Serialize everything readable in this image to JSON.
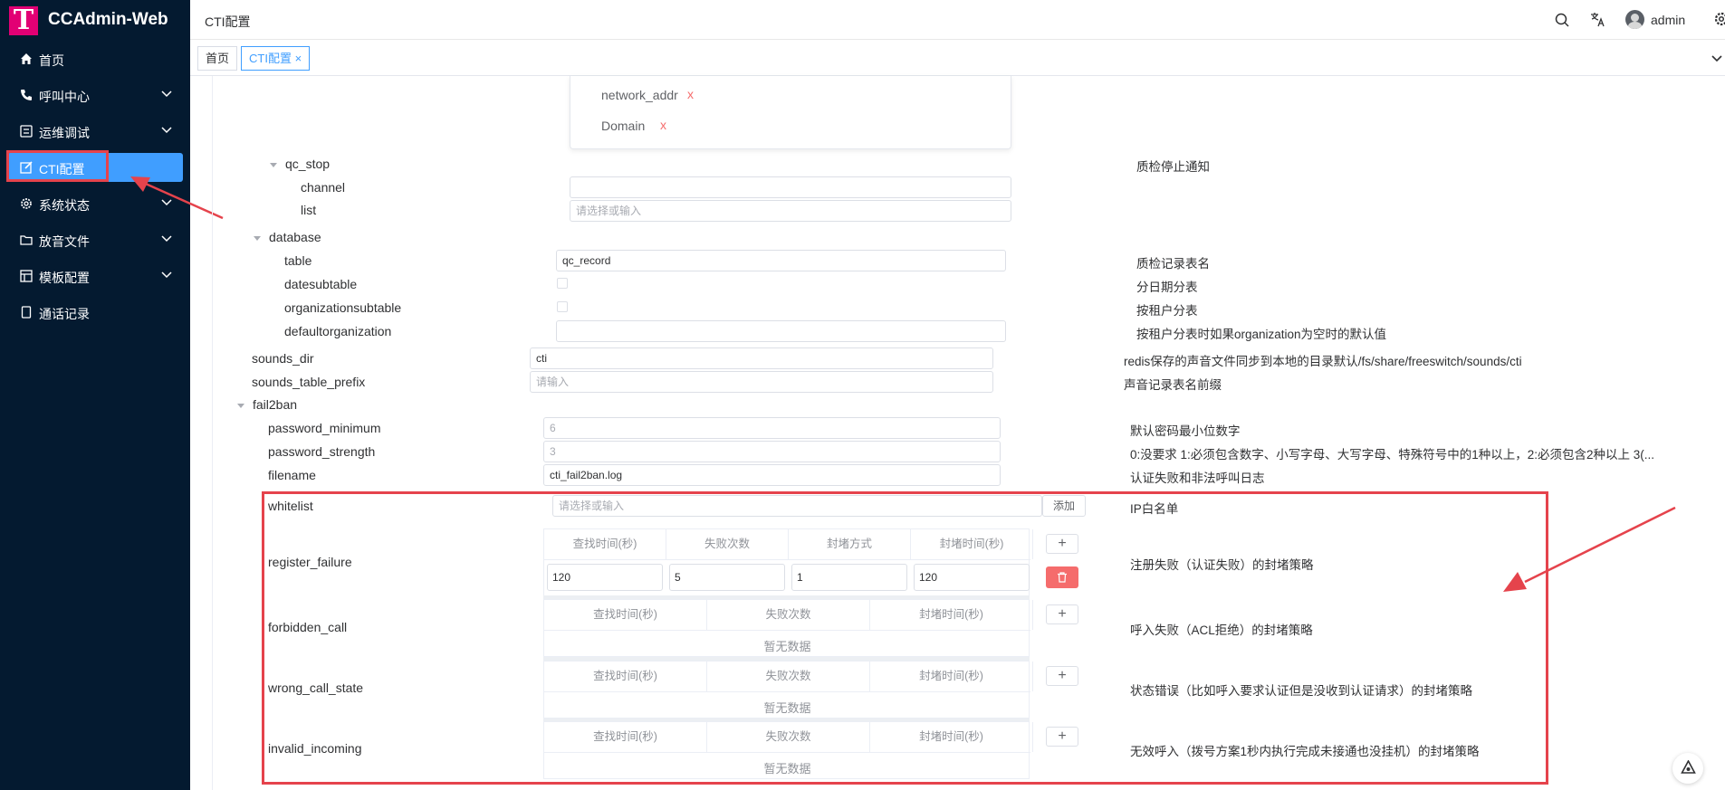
{
  "app": {
    "brand": "CCAdmin-Web",
    "logo_letter": "T"
  },
  "sidebar": {
    "items": [
      {
        "label": "首页",
        "icon": "home-icon"
      },
      {
        "label": "呼叫中心",
        "icon": "phone-icon"
      },
      {
        "label": "运维调试",
        "icon": "debug-icon"
      },
      {
        "label": "CTI配置",
        "icon": "edit-icon",
        "active": true
      },
      {
        "label": "系统状态",
        "icon": "gear-icon"
      },
      {
        "label": "放音文件",
        "icon": "folder-icon"
      },
      {
        "label": "模板配置",
        "icon": "template-icon"
      },
      {
        "label": "通话记录",
        "icon": "record-icon"
      }
    ]
  },
  "header": {
    "breadcrumb": "CTI配置",
    "user": "admin"
  },
  "tabs": [
    {
      "label": "首页"
    },
    {
      "label": "CTI配置",
      "close": "×"
    }
  ],
  "top_list": {
    "items": [
      "network_addr",
      "Domain"
    ],
    "remove": "x"
  },
  "form": {
    "qc_stop": {
      "label": "qc_stop",
      "desc": "质检停止通知",
      "channel_label": "channel",
      "channel_value": "",
      "list_label": "list",
      "list_placeholder": "请选择或输入"
    },
    "database": {
      "label": "database",
      "table_label": "table",
      "table_value": "qc_record",
      "table_desc": "质检记录表名",
      "datesubtable_label": "datesubtable",
      "datesubtable_desc": "分日期分表",
      "orgsub_label": "organizationsubtable",
      "orgsub_desc": "按租户分表",
      "defaultorg_label": "defaultorganization",
      "defaultorg_value": "",
      "defaultorg_desc": "按租户分表时如果organization为空时的默认值"
    },
    "sounds_dir": {
      "label": "sounds_dir",
      "value": "cti",
      "desc": "redis保存的声音文件同步到本地的目录默认/fs/share/freeswitch/sounds/cti"
    },
    "sounds_table_prefix": {
      "label": "sounds_table_prefix",
      "placeholder": "请输入",
      "desc": "声音记录表名前缀"
    },
    "fail2ban": {
      "label": "fail2ban",
      "password_minimum": {
        "label": "password_minimum",
        "value": "6",
        "desc": "默认密码最小位数字"
      },
      "password_strength": {
        "label": "password_strength",
        "value": "3",
        "desc": "0:没要求 1:必须包含数字、小写字母、大写字母、特殊符号中的1种以上，2:必须包含2种以上 3(..."
      },
      "filename": {
        "label": "filename",
        "value": "cti_fail2ban.log",
        "desc": "认证失败和非法呼叫日志"
      },
      "whitelist": {
        "label": "whitelist",
        "placeholder": "请选择或输入",
        "add": "添加",
        "desc": "IP白名单"
      },
      "register_failure": {
        "label": "register_failure",
        "desc": "注册失败（认证失败）的封堵策略",
        "headers": [
          "查找时间(秒)",
          "失败次数",
          "封堵方式",
          "封堵时间(秒)"
        ],
        "row": [
          "120",
          "5",
          "1",
          "120"
        ]
      },
      "forbidden_call": {
        "label": "forbidden_call",
        "desc": "呼入失败（ACL拒绝）的封堵策略",
        "headers": [
          "查找时间(秒)",
          "失败次数",
          "封堵时间(秒)"
        ],
        "empty": "暂无数据"
      },
      "wrong_call_state": {
        "label": "wrong_call_state",
        "desc": "状态错误（比如呼入要求认证但是没收到认证请求）的封堵策略",
        "headers": [
          "查找时间(秒)",
          "失败次数",
          "封堵时间(秒)"
        ],
        "empty": "暂无数据"
      },
      "invalid_incoming": {
        "label": "invalid_incoming",
        "desc": "无效呼入（拨号方案1秒内执行完成未接通也没挂机）的封堵策略",
        "headers": [
          "查找时间(秒)",
          "失败次数",
          "封堵时间(秒)"
        ],
        "empty": "暂无数据"
      },
      "plus": "+"
    }
  },
  "colors": {
    "sidebar_bg": "#041a30",
    "accent": "#409eff",
    "brand": "#e20074",
    "highlight": "#e5434c"
  }
}
